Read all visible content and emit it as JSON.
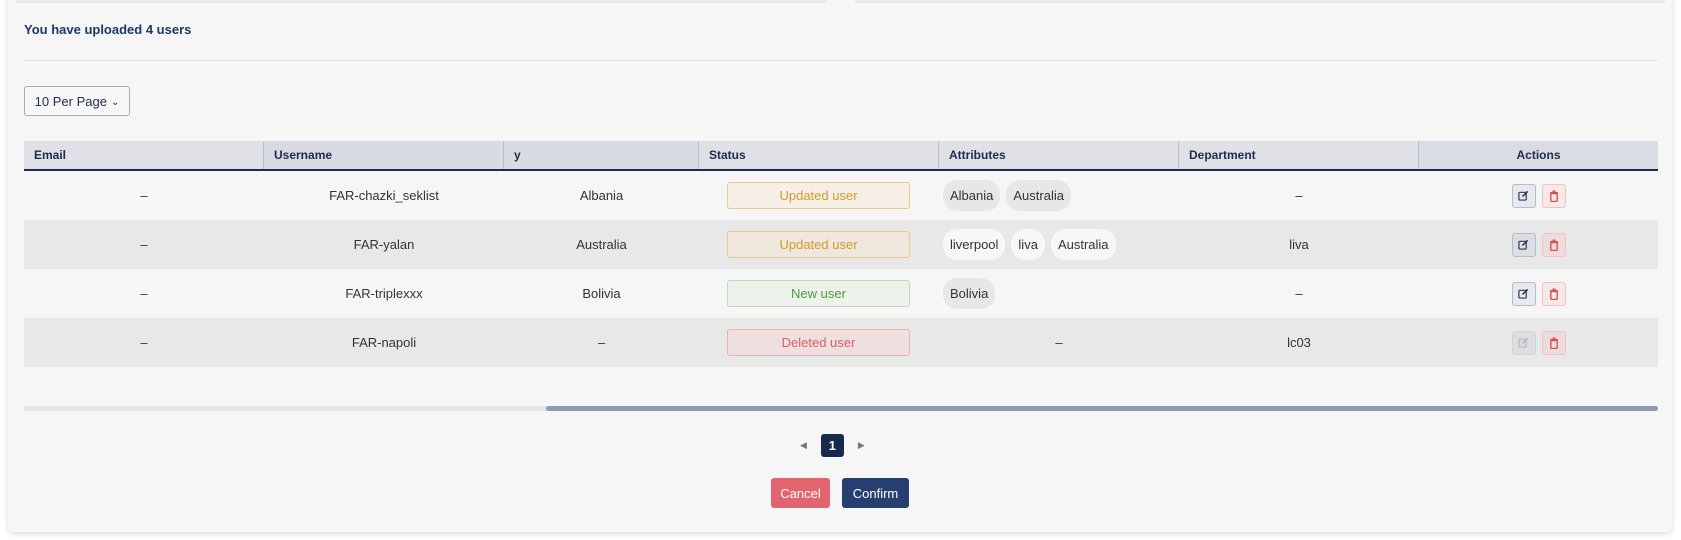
{
  "upload_summary": "You have uploaded 4 users",
  "per_page": {
    "label": "10 Per Page",
    "icon": "chevron-down-icon"
  },
  "table": {
    "headers": [
      "Email",
      "Username",
      "y",
      "Status",
      "Attributes",
      "Department",
      "Actions"
    ],
    "rows": [
      {
        "email": "–",
        "username": "FAR-chazki_seklist",
        "country": "Albania",
        "status": "Updated user",
        "status_type": "updated",
        "attributes": [
          "Albania",
          "Australia"
        ],
        "department": "–",
        "edit_disabled": false
      },
      {
        "email": "–",
        "username": "FAR-yalan",
        "country": "Australia",
        "status": "Updated user",
        "status_type": "updated",
        "attributes": [
          "liverpool",
          "liva",
          "Australia"
        ],
        "department": "liva",
        "edit_disabled": false
      },
      {
        "email": "–",
        "username": "FAR-triplexxx",
        "country": "Bolivia",
        "status": "New user",
        "status_type": "new",
        "attributes": [
          "Bolivia"
        ],
        "department": "–",
        "edit_disabled": false
      },
      {
        "email": "–",
        "username": "FAR-napoli",
        "country": "–",
        "status": "Deleted user",
        "status_type": "deleted",
        "attributes": [],
        "attributes_empty": "–",
        "department": "lc03",
        "edit_disabled": true
      }
    ]
  },
  "pagination": {
    "current_page": "1",
    "prev_icon": "caret-left-icon",
    "next_icon": "caret-right-icon"
  },
  "buttons": {
    "cancel": "Cancel",
    "confirm": "Confirm"
  },
  "colors": {
    "primary": "#263f70",
    "danger": "#e2646e",
    "status_updated": "#d39a2c",
    "status_new": "#4b9b3a",
    "status_deleted": "#e05a65"
  }
}
